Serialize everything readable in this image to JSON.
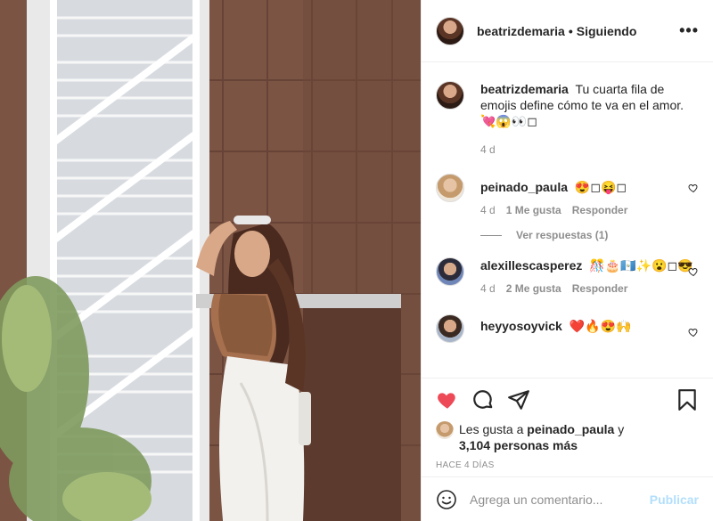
{
  "post": {
    "author": "beatrizdemaria",
    "separator": "•",
    "follow_status": "Siguiendo",
    "more": "•••"
  },
  "caption": {
    "author": "beatrizdemaria",
    "text": "Tu cuarta fila de emojis define cómo te va en el amor. 💘😱👀◻",
    "time": "4 d"
  },
  "comments": [
    {
      "author": "peinado_paula",
      "text": "😍◻😝◻",
      "time": "4 d",
      "likes": "1 Me gusta",
      "reply": "Responder"
    },
    {
      "author": "alexillescasperez",
      "text": "🎊🎂🇬🇹✨😮◻😎",
      "time": "4 d",
      "likes": "2 Me gusta",
      "reply": "Responder"
    },
    {
      "author": "heyyosoyvick",
      "text": "❤️🔥😍🙌"
    }
  ],
  "view_replies": "Ver respuestas (1)",
  "likes": {
    "prefix": "Les gusta a",
    "first_user": "peinado_paula",
    "connector": "y",
    "others": "3,104 personas más"
  },
  "posted_ago": "HACE 4 DÍAS",
  "add_comment": {
    "placeholder": "Agrega un comentario...",
    "submit": "Publicar"
  },
  "colors": {
    "liked_heart": "#ed4956",
    "publish_disabled": "#b2dffc",
    "meta_gray": "#8e8e8e"
  }
}
